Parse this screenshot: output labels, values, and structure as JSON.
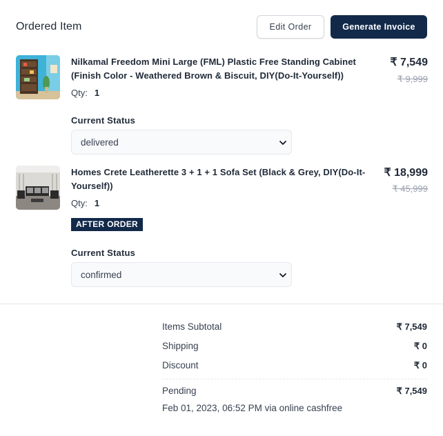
{
  "header": {
    "title": "Ordered Item",
    "edit_label": "Edit Order",
    "invoice_label": "Generate Invoice"
  },
  "items": [
    {
      "name": "Nilkamal Freedom Mini Large (FML) Plastic Free Standing Cabinet (Finish Color - Weathered Brown & Biscuit, DIY(Do-It-Yourself))",
      "price": "₹ 7,549",
      "mrp": "₹ 9,999",
      "qty_label": "Qty:",
      "qty": "1",
      "status_label": "Current Status",
      "status": "delivered",
      "thumb_icon": "cabinet-product-image"
    },
    {
      "name": "Homes Crete Leatherette 3 + 1 + 1 Sofa Set (Black & Grey, DIY(Do-It-Yourself))",
      "price": "₹ 18,999",
      "mrp": "₹ 45,999",
      "qty_label": "Qty:",
      "qty": "1",
      "badge": "AFTER ORDER",
      "status_label": "Current Status",
      "status": "confirmed",
      "thumb_icon": "sofa-product-image"
    }
  ],
  "summary": {
    "rows": [
      {
        "label": "Items Subtotal",
        "value": "₹ 7,549"
      },
      {
        "label": "Shipping",
        "value": "₹ 0"
      },
      {
        "label": "Discount",
        "value": "₹ 0"
      }
    ],
    "payment_status": "Pending",
    "payment_amount": "₹ 7,549",
    "payment_info": "Feb 01, 2023, 06:52 PM via online cashfree"
  },
  "colors": {
    "primary": "#12294a",
    "border": "#e5e7eb",
    "muted": "#9ca3af"
  }
}
